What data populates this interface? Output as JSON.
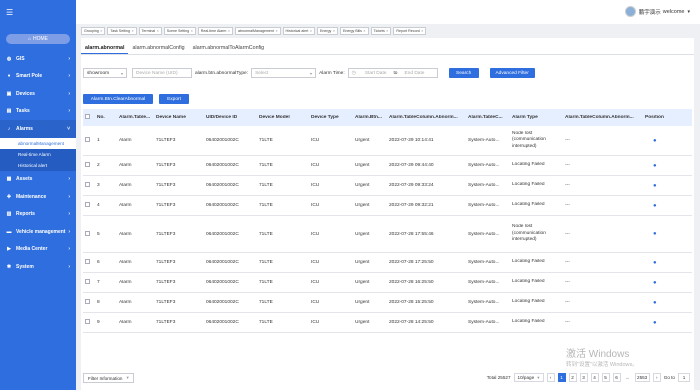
{
  "header": {
    "user_name": "鹏宇演示",
    "welcome": "welcome"
  },
  "sidebar": {
    "home": "HOME",
    "items": [
      {
        "label": "GIS",
        "icon": "globe-icon"
      },
      {
        "label": "Smart Pole",
        "icon": "pole-icon"
      },
      {
        "label": "Devices",
        "icon": "device-icon"
      },
      {
        "label": "Tasks",
        "icon": "task-icon"
      },
      {
        "label": "Alarms",
        "icon": "bell-icon"
      },
      {
        "label": "Assets",
        "icon": "asset-icon"
      },
      {
        "label": "Maintenance",
        "icon": "wrench-icon"
      },
      {
        "label": "Reports",
        "icon": "report-icon"
      },
      {
        "label": "Vehicle management",
        "icon": "car-icon"
      },
      {
        "label": "Media Center",
        "icon": "media-icon"
      },
      {
        "label": "System",
        "icon": "gear-icon"
      }
    ],
    "alarm_sub": [
      "abnormalManagement",
      "Real-time Alarm",
      "Historical alert"
    ]
  },
  "top_tabs": [
    "Grouping",
    "Task Setting",
    "Terminal",
    "Scene Setting",
    "Real-time Alarm",
    "abnormalManagement",
    "Historical alert",
    "Energy",
    "Energy Bills",
    "Tickets",
    "Report Record"
  ],
  "sub_tabs": [
    "alarm.abnormal",
    "alarm.abnormalConfig",
    "alarm.abnormalToAlarmConfig"
  ],
  "filters": {
    "show_select": "showroom",
    "device_placeholder": "Device Name (UID)",
    "type_label": "alarm.btn.abnormalType:",
    "type_placeholder": "Select",
    "alarm_time_label": "Alarm Time:",
    "start_placeholder": "Start Date",
    "to": "to",
    "end_placeholder": "End Date",
    "search": "Search",
    "advanced": "Advanced Filter"
  },
  "actions": {
    "clear": "Alarm.Btn.ClearAbnormal",
    "export": "Export"
  },
  "table": {
    "columns": [
      "No.",
      "Alarm.Table...",
      "Device Name",
      "UID/Device ID",
      "Device Model",
      "Device Type",
      "Alarm.Btn...",
      "Alarm.TableColumn.Abnorm...",
      "Alarm.TableC...",
      "Alarm Type",
      "Alarm.TableColumn.Abnorm...",
      "Position"
    ],
    "rows": [
      {
        "no": "1",
        "c1": "Alarm",
        "name": "71LTEF3",
        "uid": "06402001002C",
        "model": "71LTE",
        "dtype": "ICU",
        "level": "Urgent",
        "time": "2022-07-29 10:14:41",
        "src": "System-Auto...",
        "atype": "Node lost (communication interrupted)",
        "extra": "---"
      },
      {
        "no": "2",
        "c1": "Alarm",
        "name": "71LTEF3",
        "uid": "06402001002C",
        "model": "71LTE",
        "dtype": "ICU",
        "level": "Urgent",
        "time": "2022-07-29 09:44:40",
        "src": "System-Auto...",
        "atype": "Locating Failed",
        "extra": "---"
      },
      {
        "no": "3",
        "c1": "Alarm",
        "name": "71LTEF3",
        "uid": "06402001002C",
        "model": "71LTE",
        "dtype": "ICU",
        "level": "Urgent",
        "time": "2022-07-29 09:33:24",
        "src": "System-Auto...",
        "atype": "Locating Failed",
        "extra": "---"
      },
      {
        "no": "4",
        "c1": "Alarm",
        "name": "71LTEF3",
        "uid": "06402001002C",
        "model": "71LTE",
        "dtype": "ICU",
        "level": "Urgent",
        "time": "2022-07-29 09:32:21",
        "src": "System-Auto...",
        "atype": "Locating Failed",
        "extra": "---"
      },
      {
        "no": "5",
        "c1": "Alarm",
        "name": "71LTEF3",
        "uid": "06402001002C",
        "model": "71LTE",
        "dtype": "ICU",
        "level": "Urgent",
        "time": "2022-07-28 17:55:46",
        "src": "System-Auto...",
        "atype": "Node lost (communication interrupted)",
        "extra": "---"
      },
      {
        "no": "6",
        "c1": "Alarm",
        "name": "71LTEF3",
        "uid": "06402001002C",
        "model": "71LTE",
        "dtype": "ICU",
        "level": "Urgent",
        "time": "2022-07-28 17:25:50",
        "src": "System-Auto...",
        "atype": "Locating Failed",
        "extra": "---"
      },
      {
        "no": "7",
        "c1": "Alarm",
        "name": "71LTEF3",
        "uid": "06402001002C",
        "model": "71LTE",
        "dtype": "ICU",
        "level": "Urgent",
        "time": "2022-07-28 16:25:50",
        "src": "System-Auto...",
        "atype": "Locating Failed",
        "extra": "---"
      },
      {
        "no": "8",
        "c1": "Alarm",
        "name": "71LTEF3",
        "uid": "06402001002C",
        "model": "71LTE",
        "dtype": "ICU",
        "level": "Urgent",
        "time": "2022-07-28 15:25:50",
        "src": "System-Auto...",
        "atype": "Locating Failed",
        "extra": "---"
      },
      {
        "no": "9",
        "c1": "Alarm",
        "name": "71LTEF3",
        "uid": "06402001002C",
        "model": "71LTE",
        "dtype": "ICU",
        "level": "Urgent",
        "time": "2022-07-28 14:25:50",
        "src": "System-Auto...",
        "atype": "Locating Failed",
        "extra": "---"
      }
    ]
  },
  "footer": {
    "filter_info": "Filter Information",
    "total": "Total 25527",
    "page_size": "10/page",
    "pages": [
      "1",
      "2",
      "3",
      "4",
      "5",
      "6",
      "...",
      "2553"
    ],
    "goto": "Go to",
    "goto_value": "1"
  },
  "watermark": {
    "line1": "激活 Windows",
    "line2": "转到\"设置\"以激活 Windows。"
  },
  "colors": {
    "accent": "#2f6ede",
    "header_row": "#e6efff"
  }
}
